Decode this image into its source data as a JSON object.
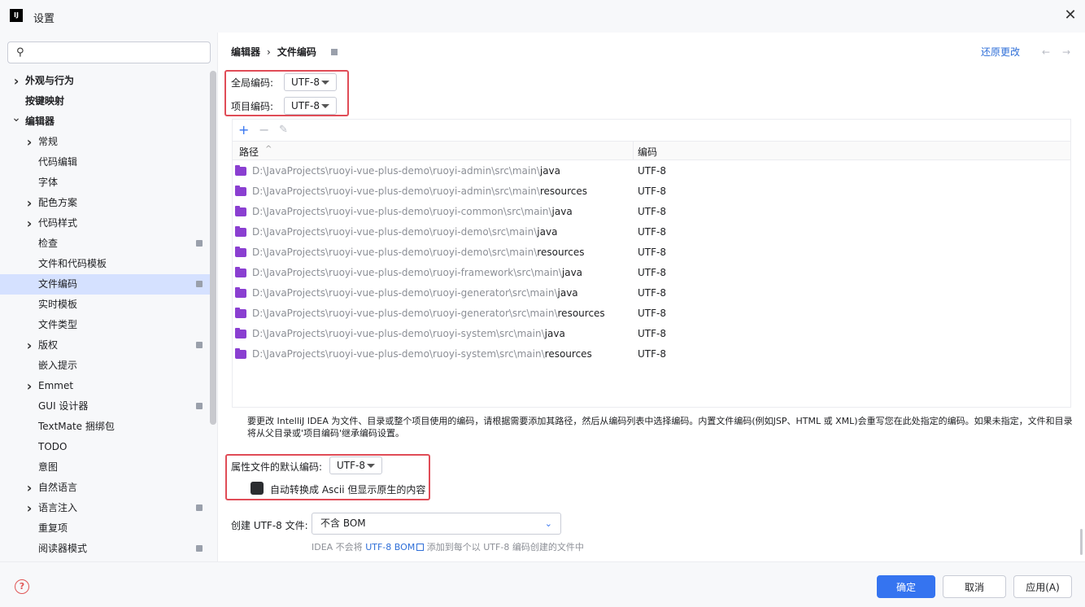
{
  "window": {
    "title": "设置",
    "app_icon_text": "IJ"
  },
  "sidebar": {
    "search": {
      "value": "",
      "placeholder": ""
    },
    "items": [
      {
        "label": "外观与行为",
        "level": 0,
        "expander": "collapsed",
        "bold": true
      },
      {
        "label": "按键映射",
        "level": 0,
        "expander": "none",
        "bold": true
      },
      {
        "label": "编辑器",
        "level": 0,
        "expander": "expanded",
        "bold": true
      },
      {
        "label": "常规",
        "level": 1,
        "expander": "collapsed"
      },
      {
        "label": "代码编辑",
        "level": 1,
        "expander": "none"
      },
      {
        "label": "字体",
        "level": 1,
        "expander": "none"
      },
      {
        "label": "配色方案",
        "level": 1,
        "expander": "collapsed"
      },
      {
        "label": "代码样式",
        "level": 1,
        "expander": "collapsed"
      },
      {
        "label": "检查",
        "level": 1,
        "expander": "none",
        "badge": true
      },
      {
        "label": "文件和代码模板",
        "level": 1,
        "expander": "none"
      },
      {
        "label": "文件编码",
        "level": 1,
        "expander": "none",
        "badge": true,
        "selected": true
      },
      {
        "label": "实时模板",
        "level": 1,
        "expander": "none"
      },
      {
        "label": "文件类型",
        "level": 1,
        "expander": "none"
      },
      {
        "label": "版权",
        "level": 1,
        "expander": "collapsed",
        "badge": true
      },
      {
        "label": "嵌入提示",
        "level": 1,
        "expander": "none"
      },
      {
        "label": "Emmet",
        "level": 1,
        "expander": "collapsed"
      },
      {
        "label": "GUI 设计器",
        "level": 1,
        "expander": "none",
        "badge": true
      },
      {
        "label": "TextMate 捆绑包",
        "level": 1,
        "expander": "none"
      },
      {
        "label": "TODO",
        "level": 1,
        "expander": "none"
      },
      {
        "label": "意图",
        "level": 1,
        "expander": "none"
      },
      {
        "label": "自然语言",
        "level": 1,
        "expander": "collapsed"
      },
      {
        "label": "语言注入",
        "level": 1,
        "expander": "collapsed",
        "badge": true
      },
      {
        "label": "重复项",
        "level": 1,
        "expander": "none"
      },
      {
        "label": "阅读器模式",
        "level": 1,
        "expander": "none",
        "badge": true
      }
    ]
  },
  "header": {
    "breadcrumb_parent": "编辑器",
    "breadcrumb_separator": "›",
    "breadcrumb_current": "文件编码",
    "revert_label": "还原更改",
    "back_arrow": "←",
    "forward_arrow": "→"
  },
  "global_encoding": {
    "label": "全局编码:",
    "value": "UTF-8"
  },
  "project_encoding": {
    "label": "项目编码:",
    "value": "UTF-8"
  },
  "table": {
    "toolbar": {
      "add": "+",
      "remove": "−",
      "edit": "✎"
    },
    "columns": {
      "path": "路径",
      "sort_indicator": "^",
      "encoding": "编码"
    },
    "rows": [
      {
        "path_prefix": "D:\\JavaProjects\\ruoyi-vue-plus-demo\\ruoyi-admin\\src\\main\\",
        "path_leaf": "java",
        "encoding": "UTF-8"
      },
      {
        "path_prefix": "D:\\JavaProjects\\ruoyi-vue-plus-demo\\ruoyi-admin\\src\\main\\",
        "path_leaf": "resources",
        "encoding": "UTF-8"
      },
      {
        "path_prefix": "D:\\JavaProjects\\ruoyi-vue-plus-demo\\ruoyi-common\\src\\main\\",
        "path_leaf": "java",
        "encoding": "UTF-8"
      },
      {
        "path_prefix": "D:\\JavaProjects\\ruoyi-vue-plus-demo\\ruoyi-demo\\src\\main\\",
        "path_leaf": "java",
        "encoding": "UTF-8"
      },
      {
        "path_prefix": "D:\\JavaProjects\\ruoyi-vue-plus-demo\\ruoyi-demo\\src\\main\\",
        "path_leaf": "resources",
        "encoding": "UTF-8"
      },
      {
        "path_prefix": "D:\\JavaProjects\\ruoyi-vue-plus-demo\\ruoyi-framework\\src\\main\\",
        "path_leaf": "java",
        "encoding": "UTF-8"
      },
      {
        "path_prefix": "D:\\JavaProjects\\ruoyi-vue-plus-demo\\ruoyi-generator\\src\\main\\",
        "path_leaf": "java",
        "encoding": "UTF-8"
      },
      {
        "path_prefix": "D:\\JavaProjects\\ruoyi-vue-plus-demo\\ruoyi-generator\\src\\main\\",
        "path_leaf": "resources",
        "encoding": "UTF-8"
      },
      {
        "path_prefix": "D:\\JavaProjects\\ruoyi-vue-plus-demo\\ruoyi-system\\src\\main\\",
        "path_leaf": "java",
        "encoding": "UTF-8"
      },
      {
        "path_prefix": "D:\\JavaProjects\\ruoyi-vue-plus-demo\\ruoyi-system\\src\\main\\",
        "path_leaf": "resources",
        "encoding": "UTF-8"
      }
    ]
  },
  "description": "要更改 IntelliJ IDEA 为文件、目录或整个项目使用的编码，请根据需要添加其路径，然后从编码列表中选择编码。内置文件编码(例如JSP、HTML 或 XML)会重写您在此处指定的编码。如果未指定，文件和目录将从父目录或'项目编码'继承编码设置。",
  "properties": {
    "label": "属性文件的默认编码:",
    "value": "UTF-8",
    "native_to_ascii_label": "自动转换成 Ascii 但显示原生的内容",
    "native_to_ascii_checked": true
  },
  "bom": {
    "label": "创建 UTF-8 文件:",
    "value": "不含 BOM",
    "chevron": "⌄",
    "hint_prefix": "IDEA 不会将 ",
    "hint_link": "UTF-8 BOM",
    "hint_suffix": " 添加到每个以 UTF-8 编码创建的文件中"
  },
  "footer": {
    "help_icon": "?",
    "ok_label": "确定",
    "cancel_label": "取消",
    "apply_label": "应用(A)"
  },
  "colors": {
    "accent": "#3574f0",
    "selection": "#d5e1ff",
    "highlight_box": "#e04c57",
    "folder_icon": "#8a3fd1"
  }
}
